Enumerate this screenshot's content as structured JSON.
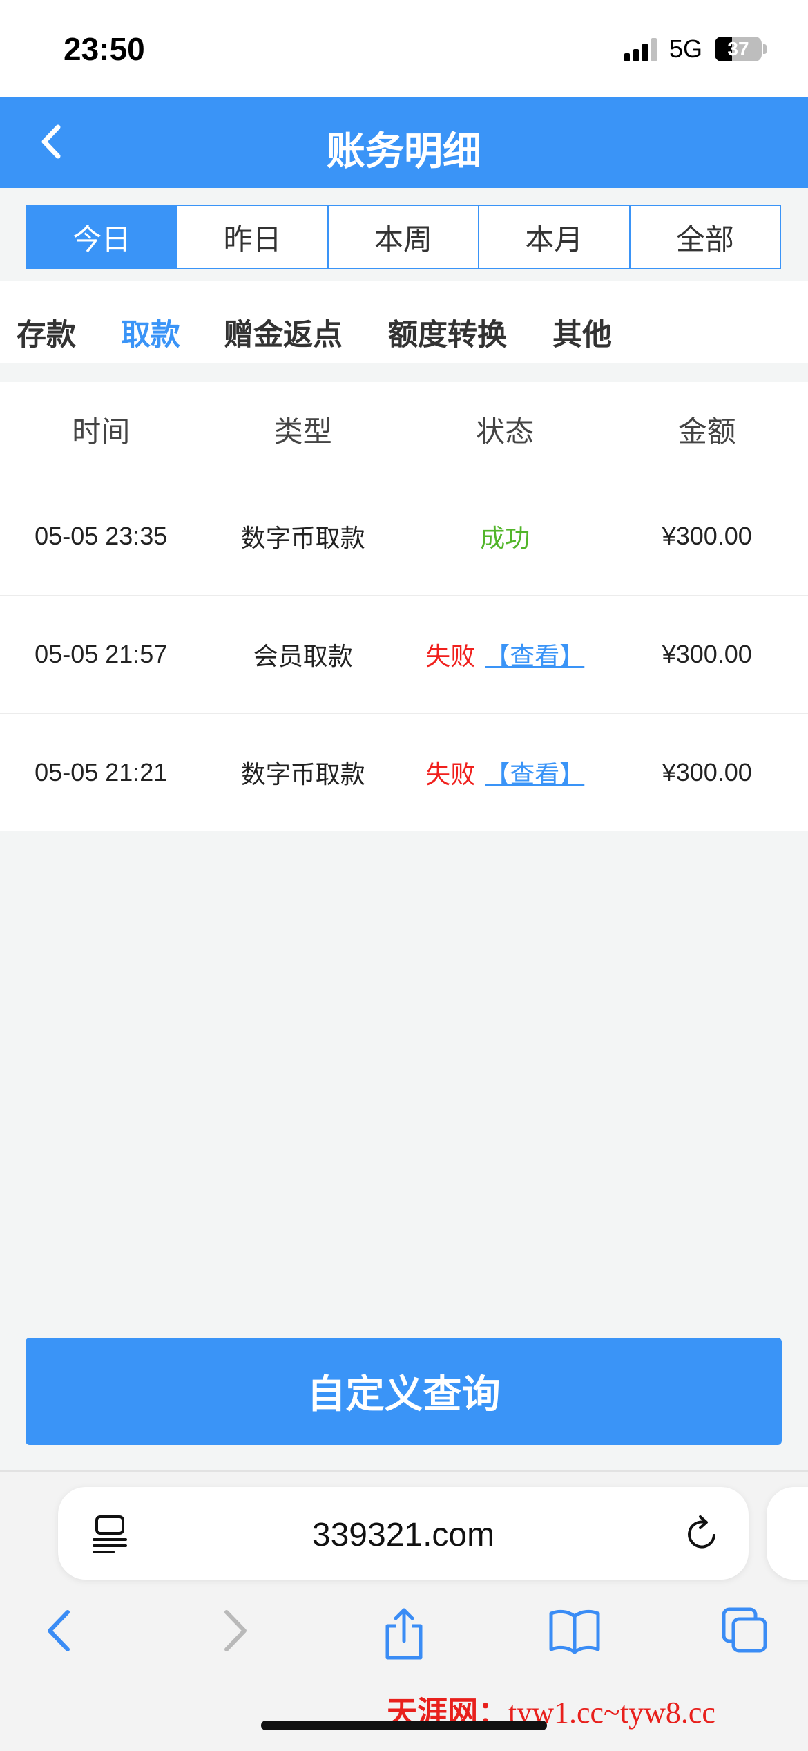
{
  "status_bar": {
    "time": "23:50",
    "network": "5G",
    "battery": "37"
  },
  "nav": {
    "title": "账务明细"
  },
  "period_tabs": [
    "今日",
    "昨日",
    "本周",
    "本月",
    "全部"
  ],
  "category_tabs": [
    "存款",
    "取款",
    "赠金返点",
    "额度转换",
    "其他"
  ],
  "table": {
    "headers": [
      "时间",
      "类型",
      "状态",
      "金额"
    ],
    "rows": [
      {
        "time": "05-05 23:35",
        "type": "数字币取款",
        "status": "成功",
        "link": "",
        "amount": "¥300.00"
      },
      {
        "time": "05-05 21:57",
        "type": "会员取款",
        "status": "失败",
        "link": "【查看】",
        "amount": "¥300.00"
      },
      {
        "time": "05-05 21:21",
        "type": "数字币取款",
        "status": "失败",
        "link": "【查看】",
        "amount": "¥300.00"
      }
    ]
  },
  "query_button": "自定义查询",
  "browser": {
    "url": "339321.com"
  },
  "watermark": {
    "site": "天涯网：",
    "urls": "tyw1.cc~tyw8.cc"
  },
  "colors": {
    "accent": "#3a94f7",
    "success": "#52b52a",
    "fail": "#f0201d",
    "watermark": "#e8201c"
  }
}
